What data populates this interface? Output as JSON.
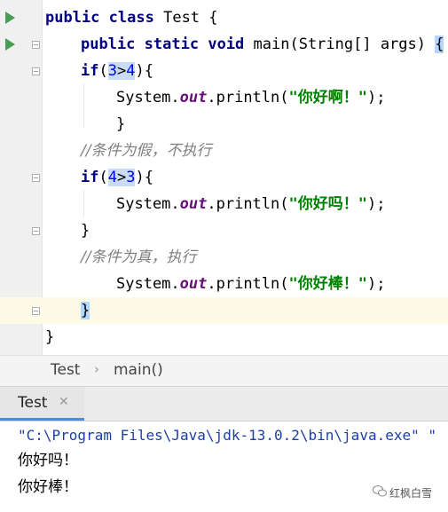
{
  "editor": {
    "lines": [
      {
        "kw1": "public",
        "kw2": "class",
        "rest": " Test {"
      },
      {
        "kw1": "public",
        "kw2": "static",
        "kw3": "void",
        "rest": " main(String[] args) ",
        "brace": "{"
      },
      {
        "kw": "if",
        "open": "(",
        "a": "3",
        "op": ">",
        "b": "4",
        "close": "){"
      },
      {
        "pre": "System.",
        "field": "out",
        "post": ".println(",
        "str": "\"你好啊！\"",
        "end": ");"
      },
      {
        "text": "}"
      },
      {
        "comment": "//条件为假，不执行"
      },
      {
        "kw": "if",
        "open": "(",
        "a": "4",
        "op": ">",
        "b": "3",
        "close": "){"
      },
      {
        "pre": "System.",
        "field": "out",
        "post": ".println(",
        "str": "\"你好吗！\"",
        "end": ");"
      },
      {
        "text": "}"
      },
      {
        "comment": "//条件为真，执行"
      },
      {
        "pre": "System.",
        "field": "out",
        "post": ".println(",
        "str": "\"你好棒！\"",
        "end": ");"
      },
      {
        "brace": "}"
      },
      {
        "text": "}"
      }
    ]
  },
  "breadcrumb": {
    "file": "Test",
    "separator": "›",
    "method": "main()"
  },
  "run": {
    "tab_label": "Test",
    "close_glyph": "✕",
    "console": [
      "\"C:\\Program Files\\Java\\jdk-13.0.2\\bin\\java.exe\" \"",
      "你好吗！",
      "你好棒！"
    ]
  },
  "watermark": {
    "text": "红枫白雪"
  },
  "colors": {
    "keyword": "#000080",
    "number": "#0000ff",
    "string": "#008000",
    "comment": "#808080",
    "field": "#660e7a",
    "run_icon": "#499c54",
    "tab_accent": "#4d8dd6"
  },
  "icons": {
    "run": "run-gutter-icon",
    "fold": "fold-icon",
    "close": "close-icon",
    "watermark": "wechat-icon"
  }
}
